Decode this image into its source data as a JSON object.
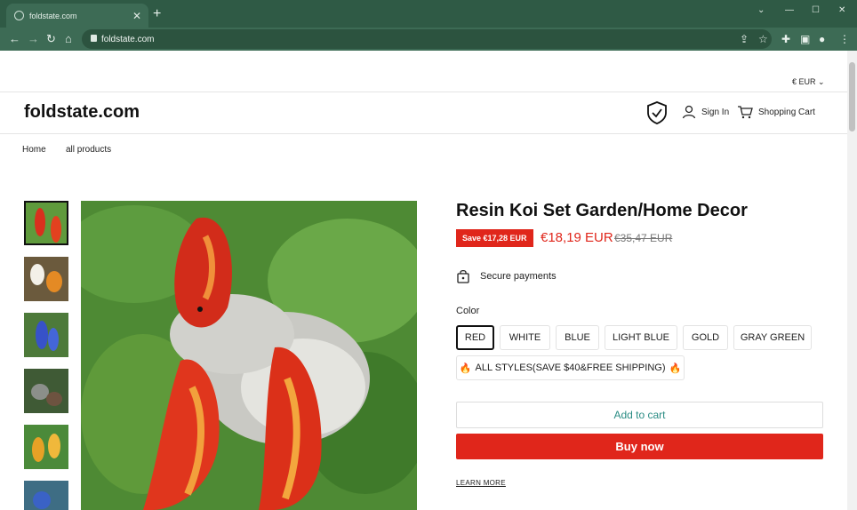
{
  "browser": {
    "tab_title": "foldstate.com",
    "tab_close": "✕",
    "new_tab": "+",
    "address": "foldstate.com",
    "window_controls": [
      "⌄",
      "—",
      "☐",
      "✕"
    ]
  },
  "site": {
    "currency": "€ EUR",
    "brand": "foldstate.com",
    "sign_in": "Sign In",
    "cart": "Shopping Cart",
    "breadcrumbs": [
      "Home",
      "all products"
    ]
  },
  "product": {
    "title": "Resin Koi Set Garden/Home Decor",
    "save_badge": "Save €17,28 EUR",
    "price": "€18,19 EUR",
    "old_price": "€35,47 EUR",
    "secure_payments": "Secure payments",
    "color_label": "Color",
    "colors": [
      "RED",
      "WHITE",
      "BLUE",
      "LIGHT BLUE",
      "GOLD",
      "GRAY GREEN"
    ],
    "bundle_option": "ALL STYLES(SAVE $40&FREE SHIPPING)",
    "add_to_cart": "Add to cart",
    "buy_now": "Buy now",
    "learn_more": "LEARN MORE"
  },
  "colors": {
    "browser_frame": "#2f5a45",
    "accent_red": "#e0261b",
    "accent_teal": "#2a8c84"
  }
}
